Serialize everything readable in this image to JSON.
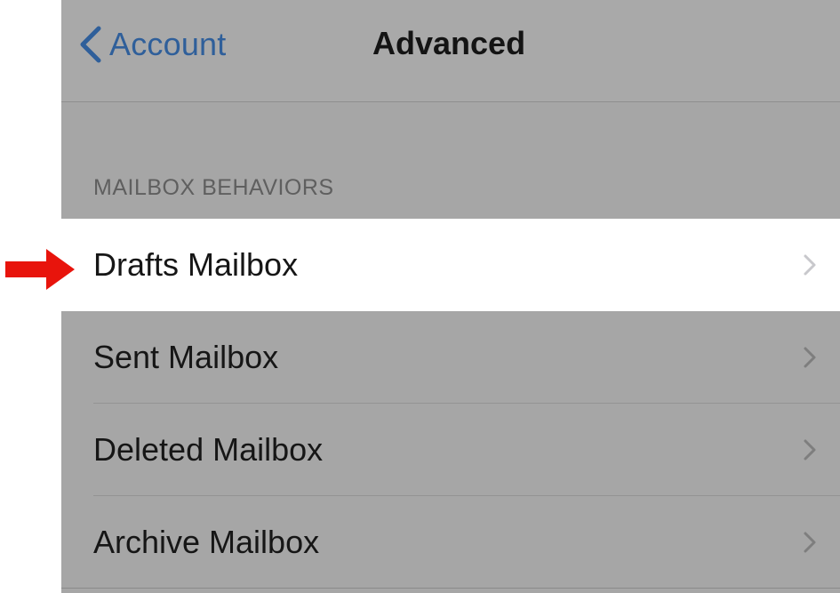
{
  "navbar": {
    "back_label": "Account",
    "title": "Advanced"
  },
  "section": {
    "header": "MAILBOX BEHAVIORS"
  },
  "rows": [
    {
      "label": "Drafts Mailbox",
      "highlighted": true
    },
    {
      "label": "Sent Mailbox",
      "highlighted": false
    },
    {
      "label": "Deleted Mailbox",
      "highlighted": false
    },
    {
      "label": "Archive Mailbox",
      "highlighted": false
    }
  ],
  "icons": {
    "back": "chevron-left-icon",
    "disclosure": "chevron-right-icon",
    "annotation": "red-arrow-icon"
  },
  "colors": {
    "accent": "#2f5f9a",
    "annotation_arrow": "#e8140c",
    "dimmed_background": "#a6a6a6",
    "highlight_row": "#ffffff"
  }
}
